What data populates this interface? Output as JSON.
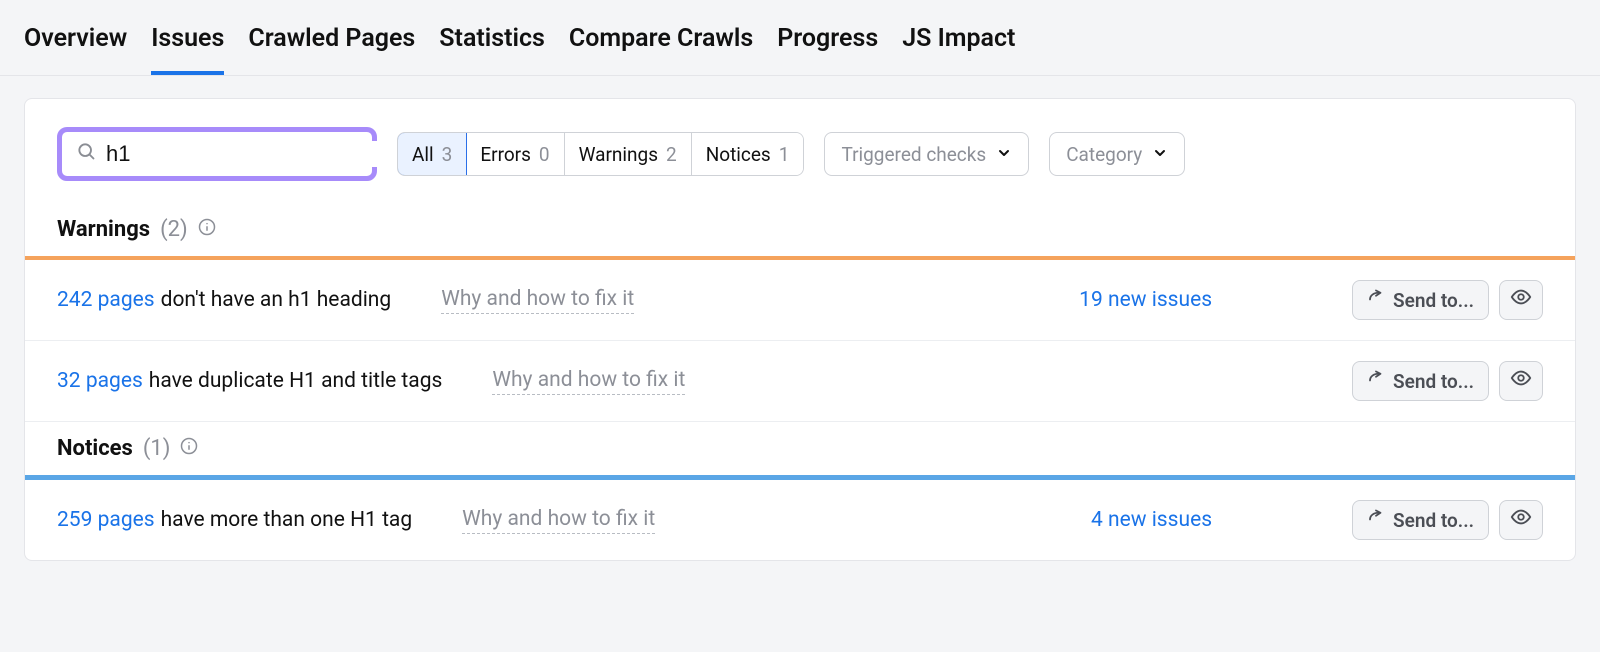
{
  "tabs": [
    {
      "label": "Overview"
    },
    {
      "label": "Issues"
    },
    {
      "label": "Crawled Pages"
    },
    {
      "label": "Statistics"
    },
    {
      "label": "Compare Crawls"
    },
    {
      "label": "Progress"
    },
    {
      "label": "JS Impact"
    }
  ],
  "active_tab": "Issues",
  "search": {
    "value": "h1"
  },
  "filters": {
    "all": {
      "label": "All",
      "count": "3"
    },
    "errors": {
      "label": "Errors",
      "count": "0"
    },
    "warnings": {
      "label": "Warnings",
      "count": "2"
    },
    "notices": {
      "label": "Notices",
      "count": "1"
    }
  },
  "dropdowns": {
    "triggered_label": "Triggered checks",
    "category_label": "Category"
  },
  "sections": {
    "warnings": {
      "title": "Warnings",
      "count": "(2)",
      "rows": [
        {
          "count_text": "242 pages",
          "rest_text": "don't have an h1 heading",
          "fix": "Why and how to fix it",
          "new_issues": "19 new issues",
          "send_label": "Send to..."
        },
        {
          "count_text": "32 pages",
          "rest_text": "have duplicate H1 and title tags",
          "fix": "Why and how to fix it",
          "new_issues": "",
          "send_label": "Send to..."
        }
      ]
    },
    "notices": {
      "title": "Notices",
      "count": "(1)",
      "rows": [
        {
          "count_text": "259 pages",
          "rest_text": "have more than one H1 tag",
          "fix": "Why and how to fix it",
          "new_issues": "4 new issues",
          "send_label": "Send to..."
        }
      ]
    }
  }
}
